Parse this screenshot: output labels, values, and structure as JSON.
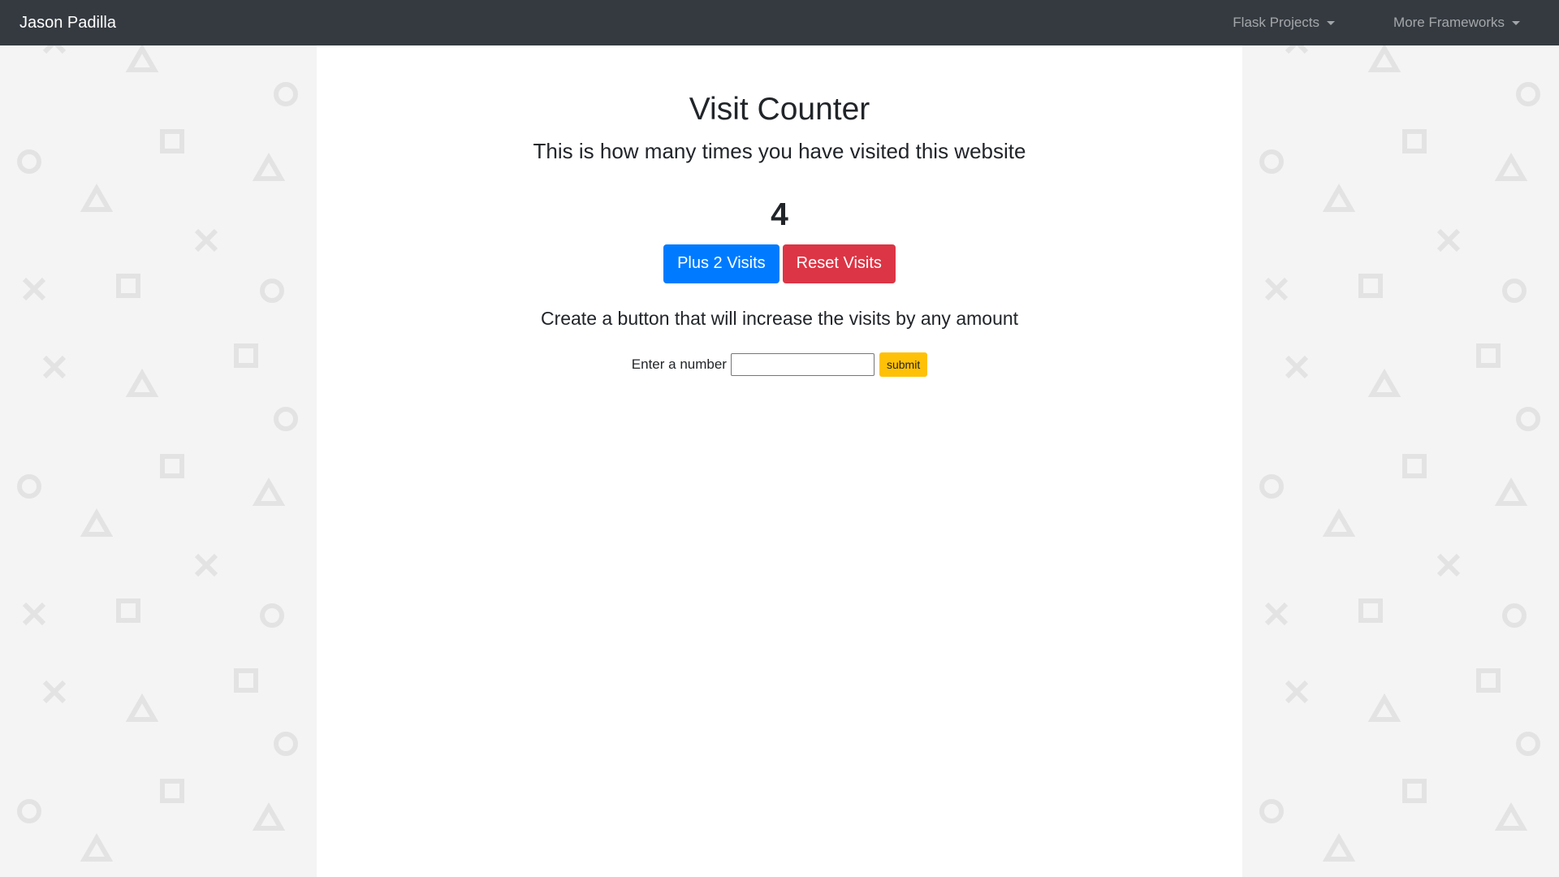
{
  "navbar": {
    "brand": "Jason Padilla",
    "dropdowns": [
      {
        "label": "Flask Projects"
      },
      {
        "label": "More Frameworks"
      }
    ]
  },
  "main": {
    "title": "Visit Counter",
    "subtitle": "This is how many times you have visited this website",
    "visit_count": "4",
    "buttons": {
      "plus_label": "Plus 2 Visits",
      "reset_label": "Reset Visits"
    },
    "create_prompt": "Create a button that will increase the visits by any amount",
    "form": {
      "label": "Enter a number",
      "input_value": "",
      "submit_label": "submit"
    }
  },
  "colors": {
    "navbar": "#343a40",
    "plus_button": "#007bff",
    "reset_button": "#dc3545",
    "submit_button": "#ffc107",
    "background_pattern": "#f4f4f4"
  },
  "icons": {
    "background_shapes": [
      "triangle-icon",
      "circle-icon",
      "square-icon",
      "cross-icon"
    ]
  }
}
